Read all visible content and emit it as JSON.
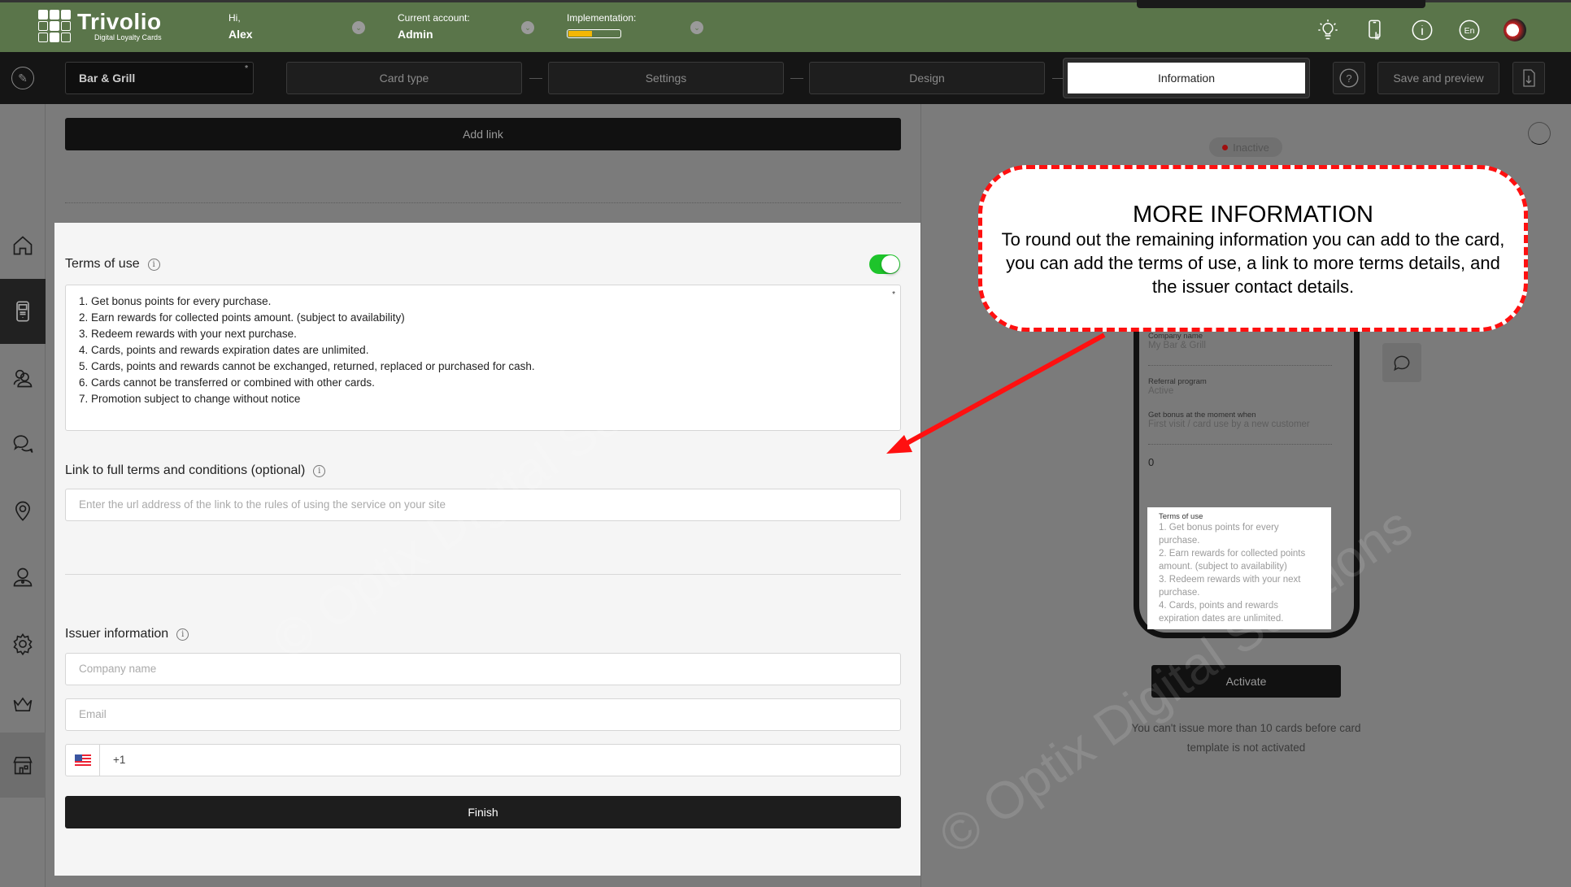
{
  "app": {
    "logo_title": "Trivolio",
    "logo_subtitle": "Digital Loyalty Cards",
    "greeting_label": "Hi,",
    "user_name": "Alex",
    "account_label": "Current account:",
    "account_value": "Admin",
    "implementation_label": "Implementation:",
    "implementation_progress_percent": 45,
    "language": "En",
    "icons": [
      "lightbulb-icon",
      "phone-touch-icon",
      "info-icon",
      "language-icon",
      "avatar"
    ]
  },
  "stepbar": {
    "card_name": "Bar & Grill",
    "required_mark": "*",
    "steps": [
      {
        "label": "Card type",
        "active": false
      },
      {
        "label": "Settings",
        "active": false
      },
      {
        "label": "Design",
        "active": false
      },
      {
        "label": "Information",
        "active": true
      }
    ],
    "help_icon": "?",
    "save_label": "Save and preview"
  },
  "sidebar": {
    "items": [
      {
        "name": "home",
        "active": false
      },
      {
        "name": "cards",
        "active": true
      },
      {
        "name": "customers",
        "active": false
      },
      {
        "name": "messages",
        "active": false
      },
      {
        "name": "locations",
        "active": false
      },
      {
        "name": "managers",
        "active": false
      },
      {
        "name": "settings",
        "active": false
      },
      {
        "name": "subscription",
        "active": false
      },
      {
        "name": "shop",
        "active": false
      }
    ]
  },
  "form": {
    "add_link_label": "Add link",
    "terms_title": "Terms of use",
    "terms_enabled": true,
    "terms_required_mark": "*",
    "terms_lines": [
      "1. Get bonus points for every purchase.",
      "2. Earn rewards for collected points amount. (subject to availability)",
      "3. Redeem rewards with your next purchase.",
      "4. Cards, points and rewards expiration dates are unlimited.",
      "5. Cards, points and rewards cannot be exchanged, returned, replaced or purchased for cash.",
      "6. Cards cannot be transferred or combined with other cards.",
      "7. Promotion subject to change without notice"
    ],
    "link_title": "Link to full terms and conditions (optional)",
    "link_placeholder": "Enter the url address of the link to the rules of using the service on your site",
    "issuer_title": "Issuer information",
    "company_placeholder": "Company name",
    "email_placeholder": "Email",
    "phone_country": "US",
    "phone_value": "+1",
    "finish_label": "Finish",
    "info_glyph": "i"
  },
  "preview": {
    "status": "Inactive",
    "company_label": "Company name",
    "company_value": "My Bar & Grill",
    "referral_label": "Referral program",
    "referral_value": "Active",
    "bonus_label": "Get bonus at the moment when",
    "bonus_value": "First visit / card use by a new customer",
    "points_value": "0",
    "terms_label": "Terms of use",
    "terms_lines": [
      "1. Get bonus points for every purchase.",
      "2. Earn rewards for collected points amount. (subject to availability)",
      "3. Redeem rewards with your next purchase.",
      "4. Cards, points and rewards expiration dates are unlimited."
    ],
    "activate_label": "Activate",
    "note": "You can't issue more than 10 cards before card template is not activated"
  },
  "callout": {
    "title": "MORE INFORMATION",
    "body": "To round out the remaining information you can add to the card, you can add the terms of use, a link to more terms details, and the issuer contact details."
  },
  "watermark": "© Optix Digital Solutions",
  "colors": {
    "header_green": "#5a754a",
    "toggle_green": "#1ec42b",
    "progress_yellow": "#f2b705",
    "callout_red": "#ff1010"
  }
}
